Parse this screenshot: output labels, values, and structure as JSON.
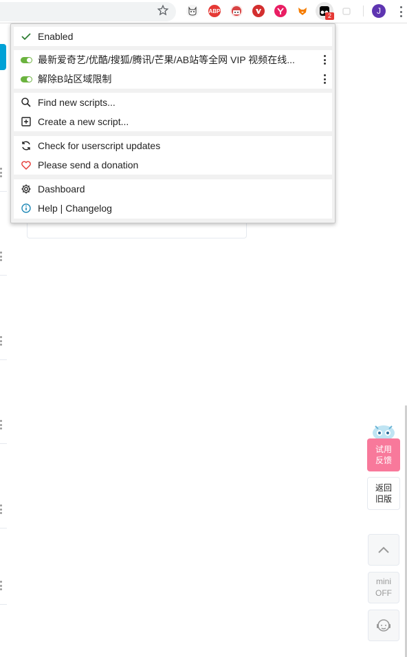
{
  "browser": {
    "extensions": [
      {
        "icon": "cat-icon",
        "color": "#f5f5f5"
      },
      {
        "icon": "adblock-plus-icon",
        "label": "ABP",
        "color": "#e53935"
      },
      {
        "icon": "mascot-icon",
        "color": "#d84343"
      },
      {
        "icon": "red-badge-icon",
        "color": "#d32f2f"
      },
      {
        "icon": "pink-y-icon",
        "color": "#e91e63"
      },
      {
        "icon": "fox-icon",
        "color": "#f57c00"
      }
    ],
    "tampermonkey_badge": "2",
    "profile_initial": "J"
  },
  "popup": {
    "enabled_label": "Enabled",
    "scripts": [
      {
        "name": "最新爱奇艺/优酷/搜狐/腾讯/芒果/AB站等全网 VIP 视频在线...",
        "enabled": true
      },
      {
        "name": "解除B站区域限制",
        "enabled": true
      }
    ],
    "actions": {
      "find_new": "Find new scripts...",
      "create_new": "Create a new script...",
      "check_updates": "Check for userscript updates",
      "donate": "Please send a donation",
      "dashboard": "Dashboard",
      "help": "Help | Changelog"
    }
  },
  "page": {
    "feedback_label_1": "试用",
    "feedback_label_2": "反馈",
    "old_version_1": "返回",
    "old_version_2": "旧版",
    "mini_label_1": "mini",
    "mini_label_2": "OFF"
  },
  "colors": {
    "toggle_on": "#6bb33f",
    "feedback": "#f8799b",
    "accent_blue": "#00a1d6"
  }
}
